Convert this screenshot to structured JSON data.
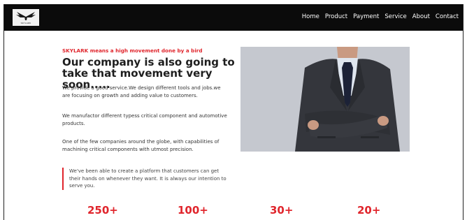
{
  "nav": {
    "logo_text": "SKYLARK",
    "links": [
      "Home",
      "Product",
      "Payment",
      "Service",
      "About",
      "Contact"
    ]
  },
  "hero": {
    "tagline": "SKYLARK means a high movement done by a bird",
    "headline": "Our company is also going to take that movement very soon.....",
    "paragraphs": [
      "We provide a good service.We design different tools and jobs.we are focusing on growth and adding value to customers.",
      "We manufactor different typess critical component and automotive products.",
      "One of the few companies around the globe, with capabilities of machining critical components with utmost precision."
    ],
    "quote": "We've been able to create a platform that customers can get their hands on whenever they want. It is always our intention to serve you."
  },
  "stats": [
    "250+",
    "100+",
    "30+",
    "20+"
  ],
  "colors": {
    "accent": "#e0252c",
    "nav_bg": "#0b0b0b"
  }
}
